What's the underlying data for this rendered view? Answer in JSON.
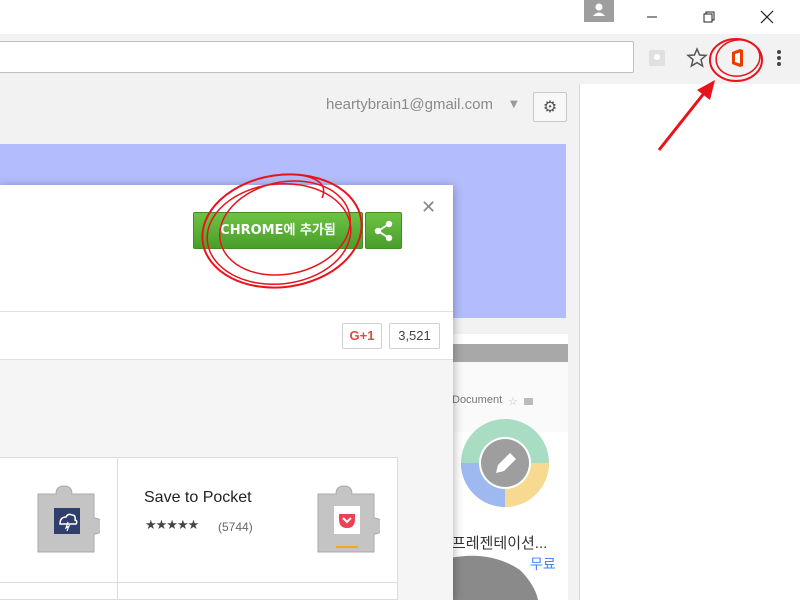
{
  "account": {
    "email": "heartybrain1@gmail.com"
  },
  "dialog": {
    "add_button_label": "CHROME에 추가됨",
    "gplus_label": "G+1",
    "gplus_count": "3,521"
  },
  "tiles": [
    {
      "name": "Save to Pocket",
      "stars": "★★★★★",
      "rating_count": "(5744)"
    }
  ],
  "background_card": {
    "doc_label": "Document",
    "title": "프레젠테이션...",
    "price": "무료"
  },
  "icons": {
    "profile": "person-icon",
    "minimize": "minimize-icon",
    "restore": "restore-icon",
    "close": "close-icon",
    "bookmark": "star-outline-icon",
    "office": "office-icon",
    "menu": "three-dot-menu-icon",
    "gear": "gear-icon",
    "share": "share-icon"
  },
  "colors": {
    "add_button": "#55ad32",
    "hero": "#b3bdfd",
    "office_orange": "#eb3c00",
    "annotation_red": "#e8131b",
    "price_blue": "#4285f4"
  }
}
